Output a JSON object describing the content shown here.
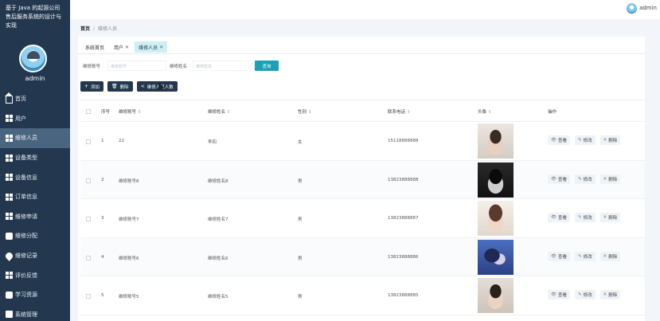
{
  "app": {
    "title": "基于 Java 的起源公司售后服务系统的设计与实现",
    "user": "admin"
  },
  "sidebar": {
    "user": "admin",
    "items": [
      {
        "label": "首页",
        "icon": "home-icon"
      },
      {
        "label": "用户",
        "icon": "grid-icon"
      },
      {
        "label": "维修人员",
        "icon": "grid-icon",
        "active": true
      },
      {
        "label": "设备类型",
        "icon": "grid-icon"
      },
      {
        "label": "设备信息",
        "icon": "grid-icon"
      },
      {
        "label": "订单信息",
        "icon": "grid-icon"
      },
      {
        "label": "维修申请",
        "icon": "grid-icon"
      },
      {
        "label": "维修分配",
        "icon": "chat-icon"
      },
      {
        "label": "维修记录",
        "icon": "pin-icon"
      },
      {
        "label": "评价反馈",
        "icon": "grid-icon"
      },
      {
        "label": "学习资源",
        "icon": "chat-icon"
      },
      {
        "label": "系统管理",
        "icon": "box-icon"
      }
    ]
  },
  "topbar": {
    "user": "admin"
  },
  "breadcrumb": {
    "home": "首页",
    "separator": "/",
    "current": "维修人员"
  },
  "tabs": [
    {
      "label": "系统首页",
      "closable": false
    },
    {
      "label": "用户",
      "closable": true
    },
    {
      "label": "维修人员",
      "closable": true,
      "active": true
    }
  ],
  "filters": {
    "account_label": "维修账号",
    "account_placeholder": "维修账号",
    "name_label": "维修姓名",
    "name_placeholder": "维修姓名",
    "search_button": "查询"
  },
  "actions": {
    "add": "添加",
    "delete": "删除",
    "share": "维修人员人数"
  },
  "table": {
    "headers": {
      "index": "序号",
      "account": "维修账号",
      "name": "维修姓名",
      "gender": "性别",
      "phone": "联系电话",
      "photo": "头像",
      "ops": "操作"
    },
    "op_labels": {
      "view": "查看",
      "edit": "修改",
      "delete": "删除"
    },
    "rows": [
      {
        "index": "1",
        "account": "22",
        "name": "李四",
        "gender": "女",
        "phone": "15118888888"
      },
      {
        "index": "2",
        "account": "维修账号8",
        "name": "维修姓名8",
        "gender": "男",
        "phone": "13823888888"
      },
      {
        "index": "3",
        "account": "维修账号7",
        "name": "维修姓名7",
        "gender": "男",
        "phone": "13823888887"
      },
      {
        "index": "4",
        "account": "维修账号6",
        "name": "维修姓名6",
        "gender": "男",
        "phone": "13823888886"
      },
      {
        "index": "5",
        "account": "维修账号5",
        "name": "维修姓名5",
        "gender": "男",
        "phone": "13823888885"
      }
    ]
  },
  "colors": {
    "sidebar_bg": "#23384f",
    "active_item": "#4a6580",
    "accent": "#1aa1b5",
    "active_tab": "#cdf0f4"
  }
}
